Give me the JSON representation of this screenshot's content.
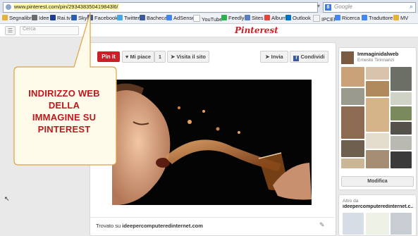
{
  "browser": {
    "url": "www.pinterest.com/pin/293438350419843l6/",
    "search_placeholder": "Google",
    "bookmarks": [
      "Segnalibri",
      "Idee",
      "Rai.tv",
      "Sky",
      "Facebook",
      "Twitter",
      "Bacheca",
      "AdSense",
      "YouTube",
      "Feedly",
      "Sites",
      "Album",
      "Outlook",
      "IPCEI",
      "Ricerca",
      "Traduttore",
      "MV"
    ]
  },
  "pinterest": {
    "search_placeholder": "Cerca",
    "logo": "Pinterest"
  },
  "pin": {
    "pin_it_label": "Pin it",
    "like_label": "Mi piace",
    "like_count": "1",
    "visit_label": "Visita il sito",
    "send_label": "Invia",
    "share_label": "Condividi",
    "found_on_prefix": "Trovato su",
    "found_on_site": "ideepercomputeredinternet.com"
  },
  "board": {
    "name": "Immaginidalweb",
    "owner": "Ernesto Tirinnanzi",
    "edit_label": "Modifica"
  },
  "other": {
    "label": "Altro da",
    "site": "ideepercomputeredinternet.c..."
  },
  "callout": {
    "lines": [
      "INDIRIZZO WEB",
      "DELLA",
      "IMMAGINE SU",
      "PINTEREST"
    ],
    "color": "#c0171d"
  },
  "colors": {
    "pinterest_red": "#cb2027",
    "highlight": "#fff7a8"
  }
}
